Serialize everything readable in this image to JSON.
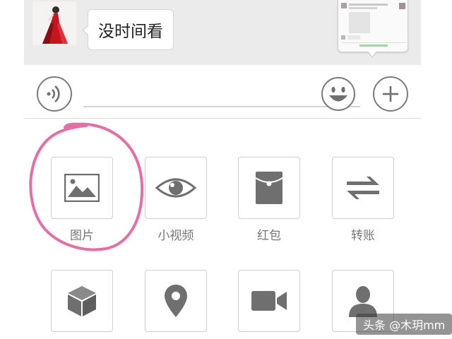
{
  "chat": {
    "message_text": "没时间看"
  },
  "input_bar": {
    "voice_icon": "voice-icon",
    "emoji_icon": "emoji-icon",
    "plus_icon": "plus-icon"
  },
  "panel": {
    "items": [
      {
        "label": "图片",
        "icon": "image-icon"
      },
      {
        "label": "小视频",
        "icon": "eye-icon"
      },
      {
        "label": "红包",
        "icon": "red-packet-icon"
      },
      {
        "label": "转账",
        "icon": "transfer-icon"
      },
      {
        "label": "",
        "icon": "cube-icon"
      },
      {
        "label": "",
        "icon": "location-pin-icon"
      },
      {
        "label": "",
        "icon": "video-camera-icon"
      },
      {
        "label": "",
        "icon": "person-icon"
      }
    ]
  },
  "annotation": {
    "color": "#e56fa2"
  },
  "watermark": {
    "text": "头条 @木玥mm"
  },
  "colors": {
    "chat_background": "#ebebeb",
    "icon_gray": "#6f6f6f",
    "border_gray": "#cfcfcf"
  }
}
